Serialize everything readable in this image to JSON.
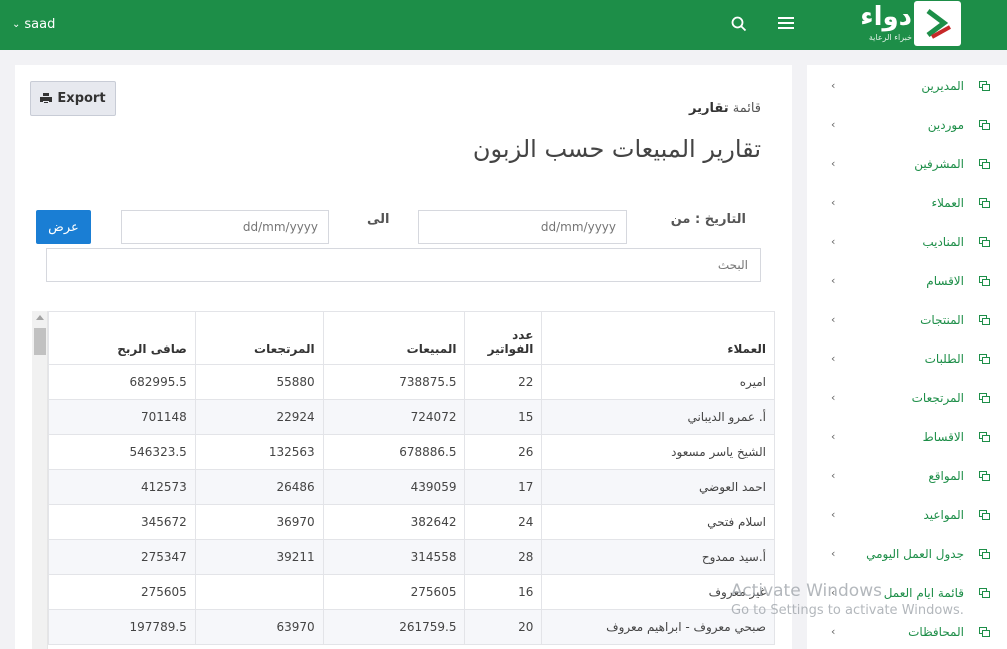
{
  "topbar": {
    "user_name": "saad",
    "logo_text": "دواء",
    "logo_subtitle": "خبراء الرعاية",
    "colors": {
      "brand_green": "#1d8e48",
      "button_blue": "#1a7ed4"
    }
  },
  "main": {
    "export_label": "Export",
    "breadcrumb_prefix": "قائمة",
    "breadcrumb_current": "تقارير",
    "title": "تقارير المبيعات حسب الزبون",
    "date_from_label": "التاريخ : من",
    "date_to_label": "الى",
    "date_from_placeholder": "dd/mm/yyyy",
    "date_to_placeholder": "dd/mm/yyyy",
    "show_button": "عرض",
    "search_placeholder": "البحث"
  },
  "table": {
    "headers": {
      "client": "العملاء",
      "invoice_count": "عدد الفواتير",
      "sales": "المبيعات",
      "returns": "المرتجعات",
      "net_profit": "صافى الربح"
    },
    "rows": [
      {
        "client": "اميره",
        "count": "22",
        "sales": "738875.5",
        "returns": "55880",
        "profit": "682995.5"
      },
      {
        "client": "أ. عمرو الديباني",
        "count": "15",
        "sales": "724072",
        "returns": "22924",
        "profit": "701148"
      },
      {
        "client": "الشيخ ياسر مسعود",
        "count": "26",
        "sales": "678886.5",
        "returns": "132563",
        "profit": "546323.5"
      },
      {
        "client": "احمد العوضي",
        "count": "17",
        "sales": "439059",
        "returns": "26486",
        "profit": "412573"
      },
      {
        "client": "اسلام فتحي",
        "count": "24",
        "sales": "382642",
        "returns": "36970",
        "profit": "345672"
      },
      {
        "client": "أ.سيد ممدوح",
        "count": "28",
        "sales": "314558",
        "returns": "39211",
        "profit": "275347"
      },
      {
        "client": "غير معروف",
        "count": "16",
        "sales": "275605",
        "returns": "",
        "profit": "275605"
      },
      {
        "client": "صبحي معروف - ابراهيم معروف",
        "count": "20",
        "sales": "261759.5",
        "returns": "63970",
        "profit": "197789.5"
      }
    ]
  },
  "sidebar": {
    "items": [
      {
        "label": "المديرين"
      },
      {
        "label": "موردين"
      },
      {
        "label": "المشرفين"
      },
      {
        "label": "العملاء"
      },
      {
        "label": "المناديب"
      },
      {
        "label": "الاقسام"
      },
      {
        "label": "المنتجات"
      },
      {
        "label": "الطلبات"
      },
      {
        "label": "المرتجعات"
      },
      {
        "label": "الاقساط"
      },
      {
        "label": "المواقع"
      },
      {
        "label": "المواعيد"
      },
      {
        "label": "جدول العمل اليومي"
      },
      {
        "label": "قائمة ايام العمل"
      },
      {
        "label": "المحافظات"
      }
    ]
  },
  "watermark": {
    "line1": "Activate Windows",
    "line2": "Go to Settings to activate Windows."
  }
}
